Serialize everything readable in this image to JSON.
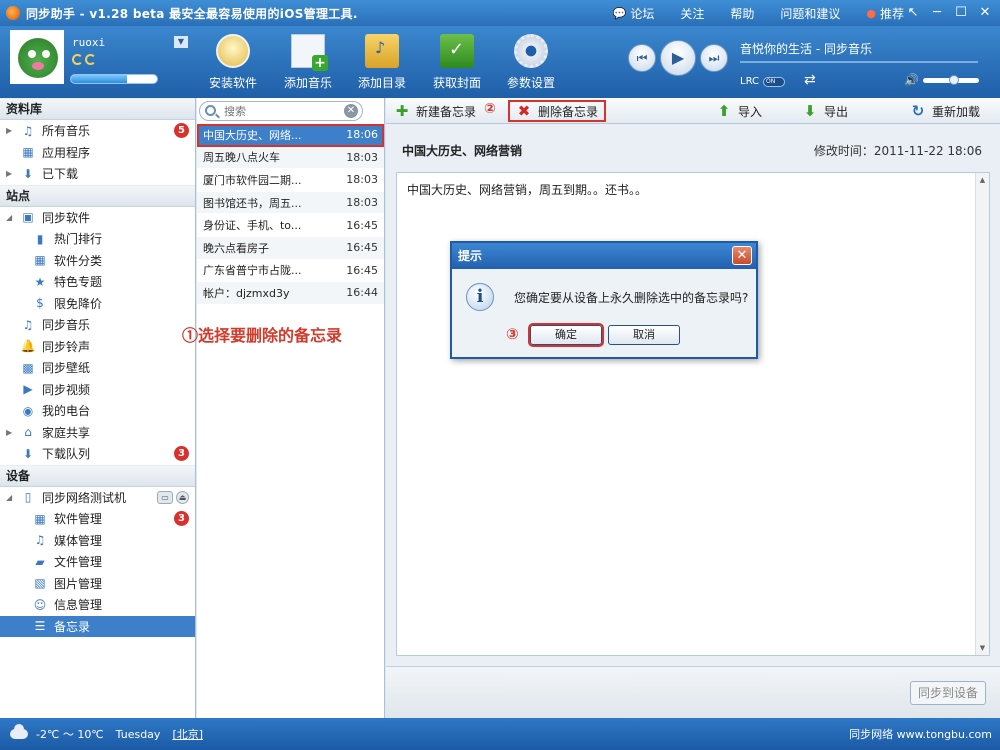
{
  "window": {
    "title": "同步助手 - v1.28 beta  最安全最容易使用的iOS管理工具.",
    "links": [
      {
        "icon": "speech-bubble-icon",
        "label": "论坛"
      },
      {
        "icon": "",
        "label": "关注"
      },
      {
        "icon": "",
        "label": "帮助"
      },
      {
        "icon": "",
        "label": "问题和建议"
      },
      {
        "icon": "weibo-icon",
        "label": "推荐"
      }
    ]
  },
  "user": {
    "name": "ruoxi",
    "storage_used_fraction": 0.65
  },
  "toolbar": {
    "buttons": [
      {
        "key": "install",
        "label": "安装软件"
      },
      {
        "key": "music",
        "label": "添加音乐"
      },
      {
        "key": "folder",
        "label": "添加目录"
      },
      {
        "key": "cover",
        "label": "获取封面"
      },
      {
        "key": "settings",
        "label": "参数设置"
      }
    ]
  },
  "player": {
    "now_playing": "音悦你的生活 - 同步音乐",
    "lrc_label": "LRC",
    "lrc_toggle": "ON",
    "volume_fraction": 0.55
  },
  "sidebar": {
    "sections": [
      {
        "title": "资料库",
        "items": [
          {
            "label": "所有音乐",
            "icon": "music-note-icon",
            "level": 0,
            "expandable": true,
            "badge": "5"
          },
          {
            "label": "应用程序",
            "icon": "apps-icon",
            "level": 0,
            "expandable": false
          },
          {
            "label": "已下载",
            "icon": "download-icon",
            "level": 0,
            "expandable": true
          }
        ]
      },
      {
        "title": "站点",
        "items": [
          {
            "label": "同步软件",
            "icon": "store-icon",
            "level": 0,
            "expandable": true,
            "expanded": true
          },
          {
            "label": "热门排行",
            "icon": "bar-chart-icon",
            "level": 1
          },
          {
            "label": "软件分类",
            "icon": "grid-icon",
            "level": 1
          },
          {
            "label": "特色专题",
            "icon": "star-icon",
            "level": 1
          },
          {
            "label": "限免降价",
            "icon": "dollar-icon",
            "level": 1
          },
          {
            "label": "同步音乐",
            "icon": "music-note-icon",
            "level": 0
          },
          {
            "label": "同步铃声",
            "icon": "bell-icon",
            "level": 0
          },
          {
            "label": "同步壁纸",
            "icon": "wallpaper-icon",
            "level": 0
          },
          {
            "label": "同步视频",
            "icon": "video-icon",
            "level": 0
          },
          {
            "label": "我的电台",
            "icon": "radio-icon",
            "level": 0
          },
          {
            "label": "家庭共享",
            "icon": "home-icon",
            "level": 0,
            "expandable": true
          },
          {
            "label": "下载队列",
            "icon": "download-icon",
            "level": 0,
            "badge": "3"
          }
        ]
      },
      {
        "title": "设备",
        "items": [
          {
            "label": "同步网络测试机",
            "icon": "phone-icon",
            "level": 0,
            "expandable": true,
            "expanded": true,
            "device": true
          },
          {
            "label": "软件管理",
            "icon": "apps-icon",
            "level": 1,
            "badge": "3"
          },
          {
            "label": "媒体管理",
            "icon": "music-note-icon",
            "level": 1
          },
          {
            "label": "文件管理",
            "icon": "folder-icon",
            "level": 1
          },
          {
            "label": "图片管理",
            "icon": "picture-icon",
            "level": 1
          },
          {
            "label": "信息管理",
            "icon": "contact-icon",
            "level": 1
          },
          {
            "label": "备忘录",
            "icon": "notes-icon",
            "level": 1,
            "active": true
          }
        ]
      }
    ]
  },
  "memos": {
    "search_placeholder": "搜索",
    "annotation": "①选择要删除的备忘录",
    "items": [
      {
        "title": "中国大历史、网络...",
        "time": "18:06",
        "selected": true
      },
      {
        "title": "周五晚八点火车",
        "time": "18:03"
      },
      {
        "title": "厦门市软件园二期...",
        "time": "18:03"
      },
      {
        "title": "图书馆还书，周五...",
        "time": "18:03"
      },
      {
        "title": "身份证、手机、to...",
        "time": "16:45"
      },
      {
        "title": "晚六点看房子",
        "time": "16:45"
      },
      {
        "title": "广东省普宁市占陇...",
        "time": "16:45"
      },
      {
        "title": "帐户：djzmxd3y",
        "time": "16:44"
      }
    ]
  },
  "actions": {
    "new_label": "新建备忘录",
    "delete_label": "删除备忘录",
    "annotation": "②",
    "import_label": "导入",
    "export_label": "导出",
    "reload_label": "重新加载"
  },
  "note": {
    "title": "中国大历史、网络营销",
    "modified": "修改时间：2011-11-22 18:06",
    "body": "中国大历史、网络营销，周五到期。。还书。。",
    "sync_label": "同步到设备"
  },
  "dialog": {
    "title": "提示",
    "message": "您确定要从设备上永久删除选中的备忘录吗?",
    "ok_label": "确定",
    "cancel_label": "取消",
    "annotation": "③"
  },
  "status": {
    "temperature": "-2℃ ～ 10℃",
    "weekday": "Tuesday",
    "city": "[北京]",
    "brand": "同步网络 www.tongbu.com"
  }
}
